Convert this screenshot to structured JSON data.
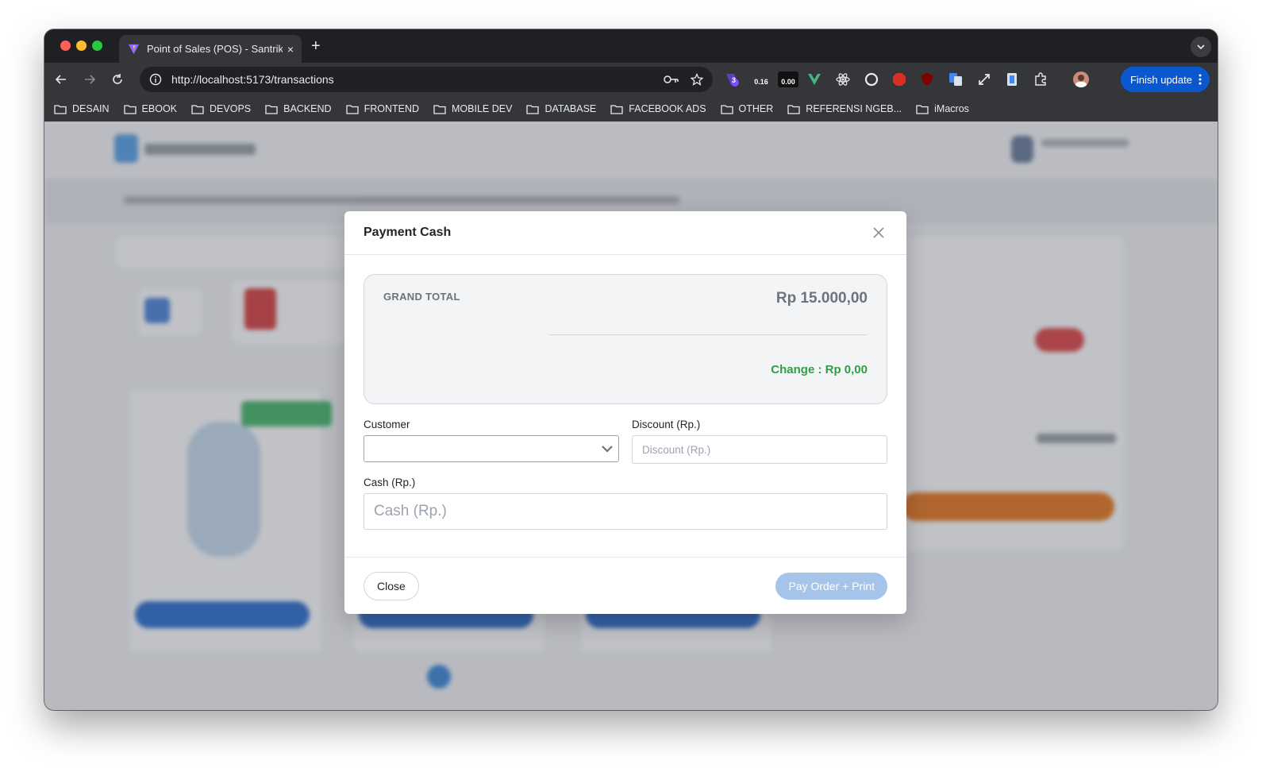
{
  "browser": {
    "tab_title": "Point of Sales (POS) - Santrik",
    "tab_close": "×",
    "new_tab": "+",
    "url": "http://localhost:5173/transactions",
    "finish_update_label": "Finish update",
    "extensions": [
      {
        "name": "ext-badge-3",
        "label": "3"
      },
      {
        "name": "ext-lcp-value",
        "label": "0.16"
      },
      {
        "name": "ext-lcp-badge",
        "label": "0.00"
      }
    ],
    "bookmarks": [
      "DESAIN",
      "EBOOK",
      "DEVOPS",
      "BACKEND",
      "FRONTEND",
      "MOBILE DEV",
      "DATABASE",
      "FACEBOOK ADS",
      "OTHER",
      "REFERENSI NGEB...",
      "iMacros"
    ]
  },
  "modal": {
    "title": "Payment Cash",
    "grand_total_label": "GRAND TOTAL",
    "grand_total_value": "Rp 15.000,00",
    "change_text": "Change : Rp 0,00",
    "customer_label": "Customer",
    "customer_value": "",
    "discount_label": "Discount (Rp.)",
    "discount_placeholder": "Discount (Rp.)",
    "cash_label": "Cash (Rp.)",
    "cash_placeholder": "Cash (Rp.)",
    "close_label": "Close",
    "pay_label": "Pay Order + Print"
  },
  "colors": {
    "change_green": "#2f9e44",
    "pay_button_disabled": "#a5c4ea",
    "finish_update_blue": "#0b57d0"
  }
}
